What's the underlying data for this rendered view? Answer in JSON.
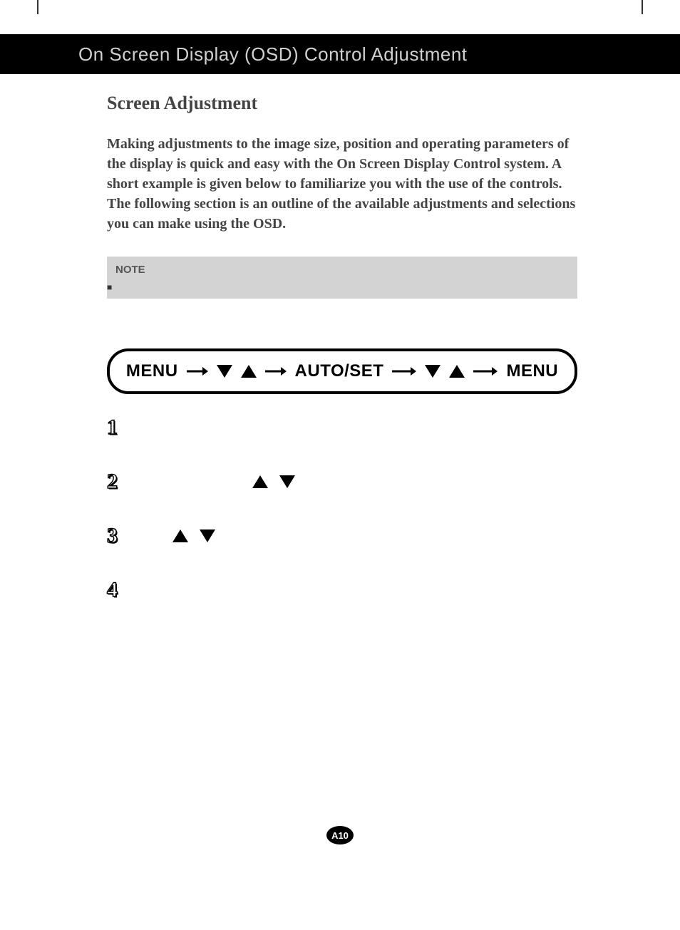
{
  "header": {
    "title": "On Screen Display (OSD) Control Adjustment"
  },
  "section": {
    "heading": "Screen Adjustment",
    "body": "Making adjustments to the image size, position and operating parameters of the display is quick and easy with the On Screen Display Control system. A short example is given below to familiarize you with the use of the controls. The following section is an outline of the available adjustments and selections you can make using the OSD."
  },
  "note": {
    "label": "NOTE"
  },
  "flow": {
    "item1": "MENU",
    "item2": "AUTO/SET",
    "item3": "MENU"
  },
  "steps": {
    "n1": "1",
    "n2": "2",
    "n3": "3",
    "n4": "4"
  },
  "footer": {
    "page": "A10"
  }
}
